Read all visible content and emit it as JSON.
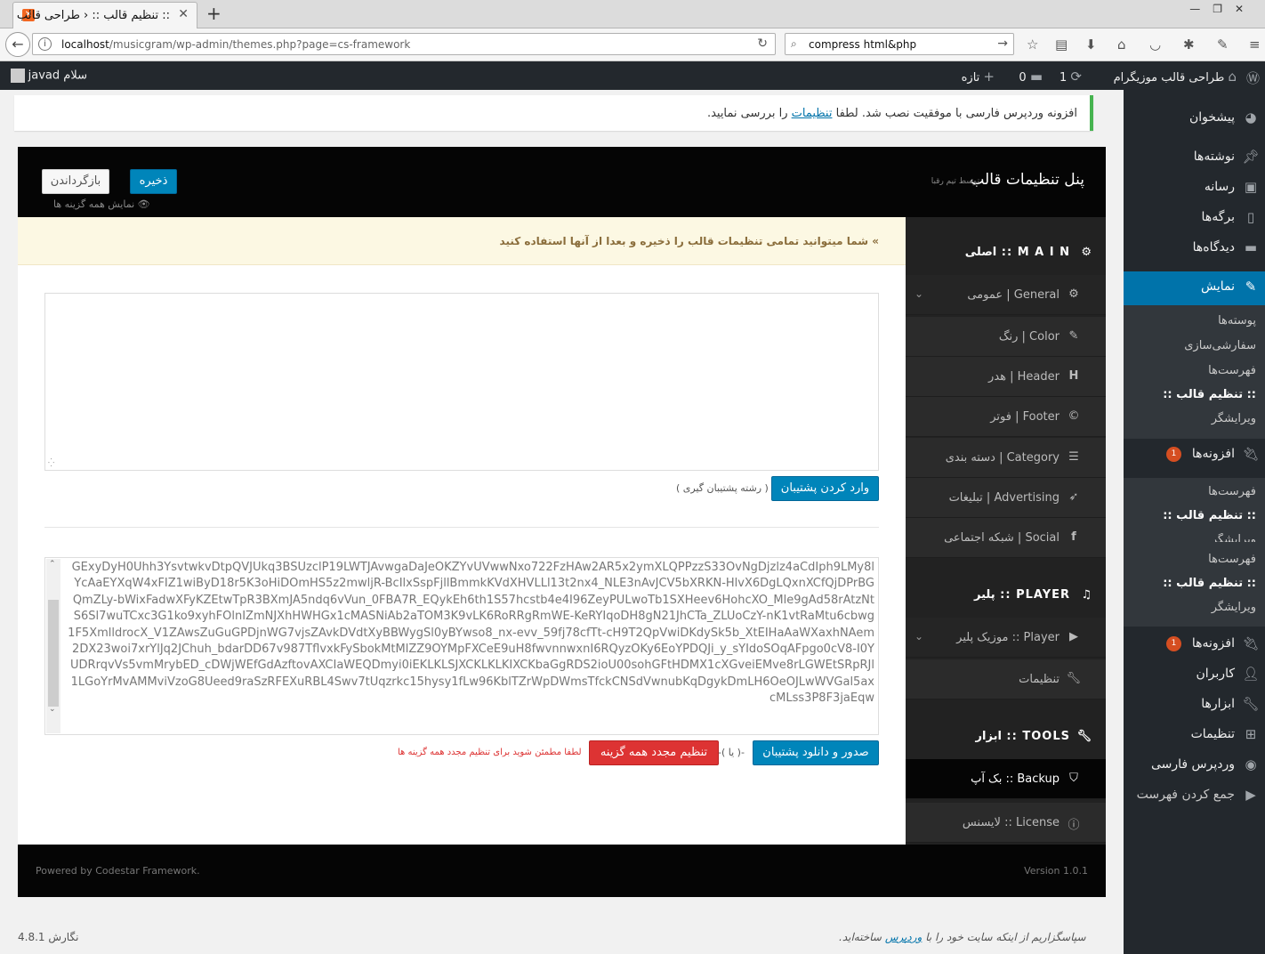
{
  "browser": {
    "tab_title": ":: تنظیم قالب :: ‹ طراحی قالب",
    "url_host": "localhost",
    "url_path": "/musicgram/wp-admin/themes.php?page=cs-framework",
    "search_query": "compress html&php"
  },
  "adminbar": {
    "site_name": "طراحی قالب موزیگرام",
    "updates_count": "1",
    "comments_count": "0",
    "new_label": "تازه",
    "greeting": "سلام javad"
  },
  "sidebar": {
    "items": [
      {
        "label": "پیشخوان",
        "icon": "dashboard-icon"
      },
      {
        "label": "نوشته‌ها",
        "icon": "pin-icon"
      },
      {
        "label": "رسانه",
        "icon": "media-icon"
      },
      {
        "label": "برگه‌ها",
        "icon": "pages-icon"
      },
      {
        "label": "دیدگاه‌ها",
        "icon": "comments-icon"
      },
      {
        "label": "نمایش",
        "icon": "appearance-icon"
      },
      {
        "label": "افزونه‌ها",
        "icon": "plugins-icon",
        "badge": "1"
      },
      {
        "label": "افزونه‌ها",
        "icon": "plugins-icon",
        "badge": "1"
      },
      {
        "label": "کاربران",
        "icon": "users-icon"
      },
      {
        "label": "ابزارها",
        "icon": "tools-icon"
      },
      {
        "label": "تنظیمات",
        "icon": "settings-icon"
      },
      {
        "label": "وردپرس فارسی",
        "icon": "wp-fa-icon"
      },
      {
        "label": "جمع کردن فهرست",
        "icon": "collapse-icon"
      }
    ],
    "appearance_sub": [
      "پوسته‌ها",
      "سفارشی‌سازی",
      "فهرست‌ها",
      ":: تنظیم قالب ::",
      "ویرایشگر"
    ],
    "plugins_sub": [
      "فهرست‌ها",
      ":: تنظیم قالب ::",
      "ویرایشگر",
      "فهرست‌ها",
      ":: تنظیم قالب ::",
      "ویرایشگر"
    ]
  },
  "notice": {
    "text_before": "افزونه وردپرس فارسی با موفقیت نصب شد. لطفا",
    "link": "تنظیمات",
    "text_after": "را بررسی نمایید."
  },
  "panel": {
    "title": "پنل تنظیمات قالب",
    "by": "توسط تیم رقبا",
    "save_label": "ذخیره",
    "reset_label": "بازگرداندن",
    "show_all": "نمایش همه گزینه ها",
    "warning": "» شما میتوانید تمامی تنظیمات قالب را ذخیره و بعدا از آنها استفاده کنید",
    "import_button": "وارد کردن پشتیبان",
    "import_note": "( رشته پشتیبان گیری )",
    "export_code": "GExyDyH0Uhh3YsvtwkvDtpQVJUkq3BSUzclP19LWTJAvwgaDaJeOKZYvUVwwNxo722FzHAw2AR5x2ymXLQPPzzS33OvNgDjzlz4aCdIph9LMy8lYcAaEYXqW4xFIZ1wiByD18r5K3oHiDOmHS5z2mwljR-BcIlxSspFjllBmmkKVdXHVLLl13t2nx4_NLE3nAvJCV5bXRKN-HlvX6DgLQxnXCfQjDPrBGQmZLy-bWixFadwXFyKZEtwTpR3BXmJA5ndq6vVun_0FBA7R_EQykEh6th1S57hcstb4e4I96ZeyPULwoTb1SXHeev6HohcXO_Mle9gAd58rAtzNtS6Sl7wuTCxc3G1ko9xyhFOlnIZmNJXhHWHGx1cMASNiAb2aTOM3K9vLK6RoRRgRmWE-KeRYIqoDH8gN21JhCTa_ZLUoCzY-nK1vtRaMtu6cbwg1F5XmlldrocX_V1ZAwsZuGuGPDjnWG7vjsZAvkDVdtXyBBWygSl0yBYwso8_nx-evv_59fj78cfTt-cH9T2QpVwiDKdySk5b_XtEIHaAaWXaxhNAem2DX23woi7xrYlJq2JChuh_bdarDD67v987TflvxkFySbokMtMlZZ9OYMpFXCeE9uH8fwvnnwxnI6RQyzOKy6EoYPDQJi_y_sYIdoSOqAFpgo0cV8-I0YUDRrqvVs5vmMrybED_cDWjWEfGdAzftovAXCIaWEQDmyi0iEKLKLSJXCKLKLKIXCKbaGgRDS2ioU00sohGFtHDMX1cXGveiEMve8rLGWEtSRpRJl1LGoYrMvAMMviVzoG8Ueed9raSzRFEXuRBL4Swv7tUqzrkc15hysy1fLw96KblTZrWpDWmsTfckCNSdVwnubKqDgykDmLH6OeOJLwWVGal5axcMLss3P8F3jaEqw",
    "export_button": "صدور و دانلود پشتیبان",
    "or_label": "-( یا )-",
    "reset_all_button": "تنظیم مجدد همه گزینه",
    "reset_warning": "لطفا مطمئن شوید برای تنظیم مجدد همه گزینه ها",
    "version": "Version 1.0.1",
    "powered": "Powered by Codestar Framework."
  },
  "csnav": {
    "main_title": "M A I N :: اصلی",
    "main_items": [
      {
        "label": "General | عمومی",
        "icon": "gear-icon"
      },
      {
        "label": "Color | رنگ",
        "icon": "brush-icon"
      },
      {
        "label": "Header | هدر",
        "icon": "h-icon"
      },
      {
        "label": "Footer | فوتر",
        "icon": "copyright-icon"
      },
      {
        "label": "Category | دسته بندی",
        "icon": "list-icon"
      },
      {
        "label": "Advertising | تبلیغات",
        "icon": "rocket-icon"
      },
      {
        "label": "Social | شبکه اجتماعی",
        "icon": "facebook-icon"
      }
    ],
    "player_title": "PLAYER :: پلیر",
    "player_items": [
      {
        "label": "Player :: موزیک پلیر",
        "icon": "play-icon"
      },
      {
        "label": "تنظیمات",
        "icon": "wrench-icon"
      }
    ],
    "tools_title": "TOOLS :: ابزار",
    "tools_items": [
      {
        "label": "Backup :: بک آپ",
        "icon": "shield-icon"
      },
      {
        "label": "License :: لایسنس",
        "icon": "info-icon"
      }
    ]
  },
  "wpfooter": {
    "thanks_before": "سپاسگزاریم از اینکه سایت خود را با",
    "thanks_link": "وردپرس",
    "thanks_after": "ساخته‌اید.",
    "version": "نگارش 4.8.1"
  },
  "colors": {
    "accent": "#0073aa",
    "button": "#0085ba",
    "danger": "#dd3333",
    "sidebar": "#23282d",
    "notice_border": "#46b450"
  }
}
